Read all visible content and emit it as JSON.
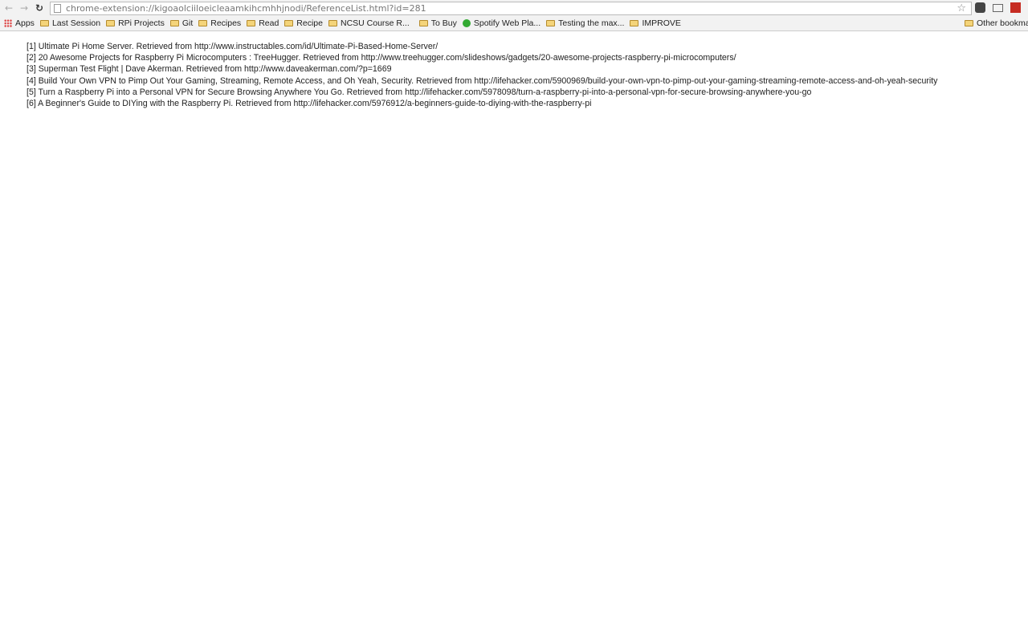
{
  "browser": {
    "url": "chrome-extension://kigoaolciiloeicleaamkihcmhhjnodi/ReferenceList.html?id=281",
    "nav": {
      "back_icon": "arrow-left",
      "forward_icon": "arrow-right",
      "reload_icon": "reload"
    },
    "extensions": [
      "star-icon",
      "pocket-icon",
      "cast-icon",
      "red-book-icon"
    ]
  },
  "bookmarks": {
    "apps": "Apps",
    "items": [
      "Last Session",
      "RPi Projects",
      "Git",
      "Recipes",
      "Read",
      "Recipe",
      "NCSU Course R...",
      "To Buy",
      "Spotify Web Pla...",
      "Testing the max...",
      "IMPROVE"
    ],
    "other": "Other bookma"
  },
  "references": [
    "[1] Ultimate Pi Home Server. Retrieved from http://www.instructables.com/id/Ultimate-Pi-Based-Home-Server/",
    "[2] 20 Awesome Projects for Raspberry Pi Microcomputers : TreeHugger. Retrieved from http://www.treehugger.com/slideshows/gadgets/20-awesome-projects-raspberry-pi-microcomputers/",
    "[3] Superman Test Flight | Dave Akerman. Retrieved from http://www.daveakerman.com/?p=1669",
    "[4] Build Your Own VPN to Pimp Out Your Gaming, Streaming, Remote Access, and Oh Yeah, Security. Retrieved from http://lifehacker.com/5900969/build-your-own-vpn-to-pimp-out-your-gaming-streaming-remote-access-and-oh-yeah-security",
    "[5] Turn a Raspberry Pi into a Personal VPN for Secure Browsing Anywhere You Go. Retrieved from http://lifehacker.com/5978098/turn-a-raspberry-pi-into-a-personal-vpn-for-secure-browsing-anywhere-you-go",
    "[6] A Beginner's Guide to DIYing with the Raspberry Pi. Retrieved from http://lifehacker.com/5976912/a-beginners-guide-to-diying-with-the-raspberry-pi"
  ]
}
